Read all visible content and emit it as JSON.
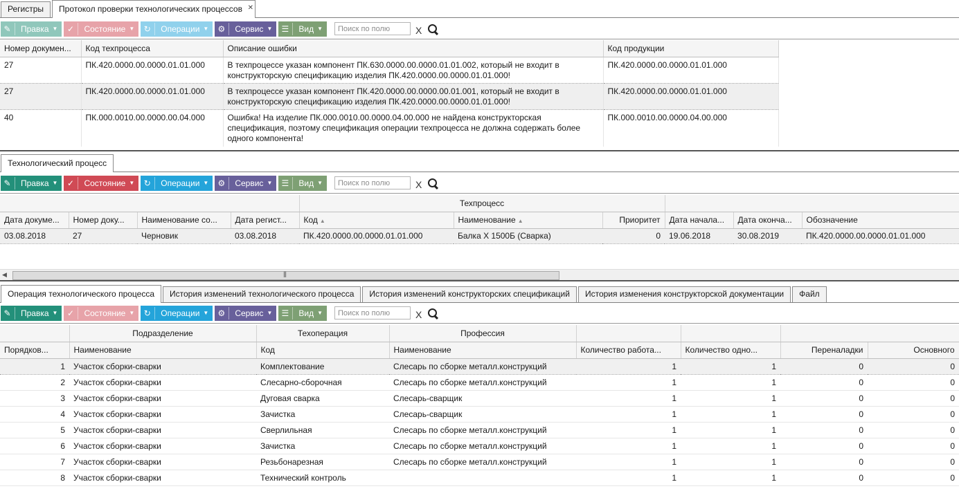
{
  "top_tabs": [
    "Регистры",
    "Протокол проверки технологических процессов"
  ],
  "toolbar": {
    "edit": "Правка",
    "state": "Состояние",
    "operations": "Операции",
    "service": "Сервис",
    "view": "Вид",
    "search_placeholder": "Поиск по полю",
    "clear": "X"
  },
  "protocol": {
    "headers": [
      "Номер докумен...",
      "Код техпроцесса",
      "Описание ошибки",
      "Код продукции"
    ],
    "rows": [
      {
        "num": "27",
        "code": "ПК.420.0000.00.0000.01.01.000",
        "error": "В техпроцессе указан компонент ПК.630.0000.00.0000.01.01.002, который не входит в конструкторскую спецификацию изделия ПК.420.0000.00.0000.01.01.000!",
        "product": "ПК.420.0000.00.0000.01.01.000"
      },
      {
        "num": "27",
        "code": "ПК.420.0000.00.0000.01.01.000",
        "error": "В техпроцессе указан компонент ПК.420.0000.00.0000.00.01.001, который не входит в конструкторскую спецификацию изделия ПК.420.0000.00.0000.01.01.000!",
        "product": "ПК.420.0000.00.0000.01.01.000"
      },
      {
        "num": "40",
        "code": "ПК.000.0010.00.0000.00.04.000",
        "error": "Ошибка! На изделие ПК.000.0010.00.0000.04.00.000 не найдена конструкторская спецификация, поэтому спецификация операции техпроцесса не должна содержать более одного компонента!",
        "product": "ПК.000.0010.00.0000.04.00.000"
      }
    ]
  },
  "process_tab": "Технологический процесс",
  "process": {
    "group_header": "Техпроцесс",
    "headers": [
      "Дата докуме...",
      "Номер доку...",
      "Наименование со...",
      "Дата регист...",
      "Код",
      "Наименование",
      "Приоритет",
      "Дата начала...",
      "Дата оконча...",
      "Обозначение"
    ],
    "row": {
      "date_doc": "03.08.2018",
      "num_doc": "27",
      "state": "Черновик",
      "date_reg": "03.08.2018",
      "code": "ПК.420.0000.00.0000.01.01.000",
      "name": "Балка Х 1500Б (Сварка)",
      "priority": "0",
      "date_start": "19.06.2018",
      "date_end": "30.08.2019",
      "designation": "ПК.420.0000.00.0000.01.01.000"
    }
  },
  "bottom_tabs": [
    "Операция технологического процесса",
    "История изменений технологического процесса",
    "История изменений конструкторских спецификаций",
    "История изменения конструкторской документации",
    "Файл"
  ],
  "operations": {
    "group_headers": {
      "department": "Подразделение",
      "operation": "Техоперация",
      "profession": "Профессия"
    },
    "headers": [
      "Порядков...",
      "Наименование",
      "Код",
      "Наименование",
      "Количество работа...",
      "Количество одно...",
      "Переналадки",
      "Основного"
    ],
    "rows": [
      {
        "n": "1",
        "dept": "Участок сборки-сварки",
        "op": "Комплектование",
        "prof": "Слесарь по сборке металл.конструкций",
        "workers": "1",
        "simul": "1",
        "setup": "0",
        "main": "0"
      },
      {
        "n": "2",
        "dept": "Участок сборки-сварки",
        "op": "Слесарно-сборочная",
        "prof": "Слесарь по сборке металл.конструкций",
        "workers": "1",
        "simul": "1",
        "setup": "0",
        "main": "0"
      },
      {
        "n": "3",
        "dept": "Участок сборки-сварки",
        "op": "Дуговая сварка",
        "prof": "Слесарь-сварщик",
        "workers": "1",
        "simul": "1",
        "setup": "0",
        "main": "0"
      },
      {
        "n": "4",
        "dept": "Участок сборки-сварки",
        "op": "Зачистка",
        "prof": "Слесарь-сварщик",
        "workers": "1",
        "simul": "1",
        "setup": "0",
        "main": "0"
      },
      {
        "n": "5",
        "dept": "Участок сборки-сварки",
        "op": "Сверлильная",
        "prof": "Слесарь по сборке металл.конструкций",
        "workers": "1",
        "simul": "1",
        "setup": "0",
        "main": "0"
      },
      {
        "n": "6",
        "dept": "Участок сборки-сварки",
        "op": "Зачистка",
        "prof": "Слесарь по сборке металл.конструкций",
        "workers": "1",
        "simul": "1",
        "setup": "0",
        "main": "0"
      },
      {
        "n": "7",
        "dept": "Участок сборки-сварки",
        "op": "Резьбонарезная",
        "prof": "Слесарь по сборке металл.конструкций",
        "workers": "1",
        "simul": "1",
        "setup": "0",
        "main": "0"
      },
      {
        "n": "8",
        "dept": "Участок сборки-сварки",
        "op": "Технический контроль",
        "prof": "",
        "workers": "1",
        "simul": "1",
        "setup": "0",
        "main": "0"
      }
    ]
  }
}
